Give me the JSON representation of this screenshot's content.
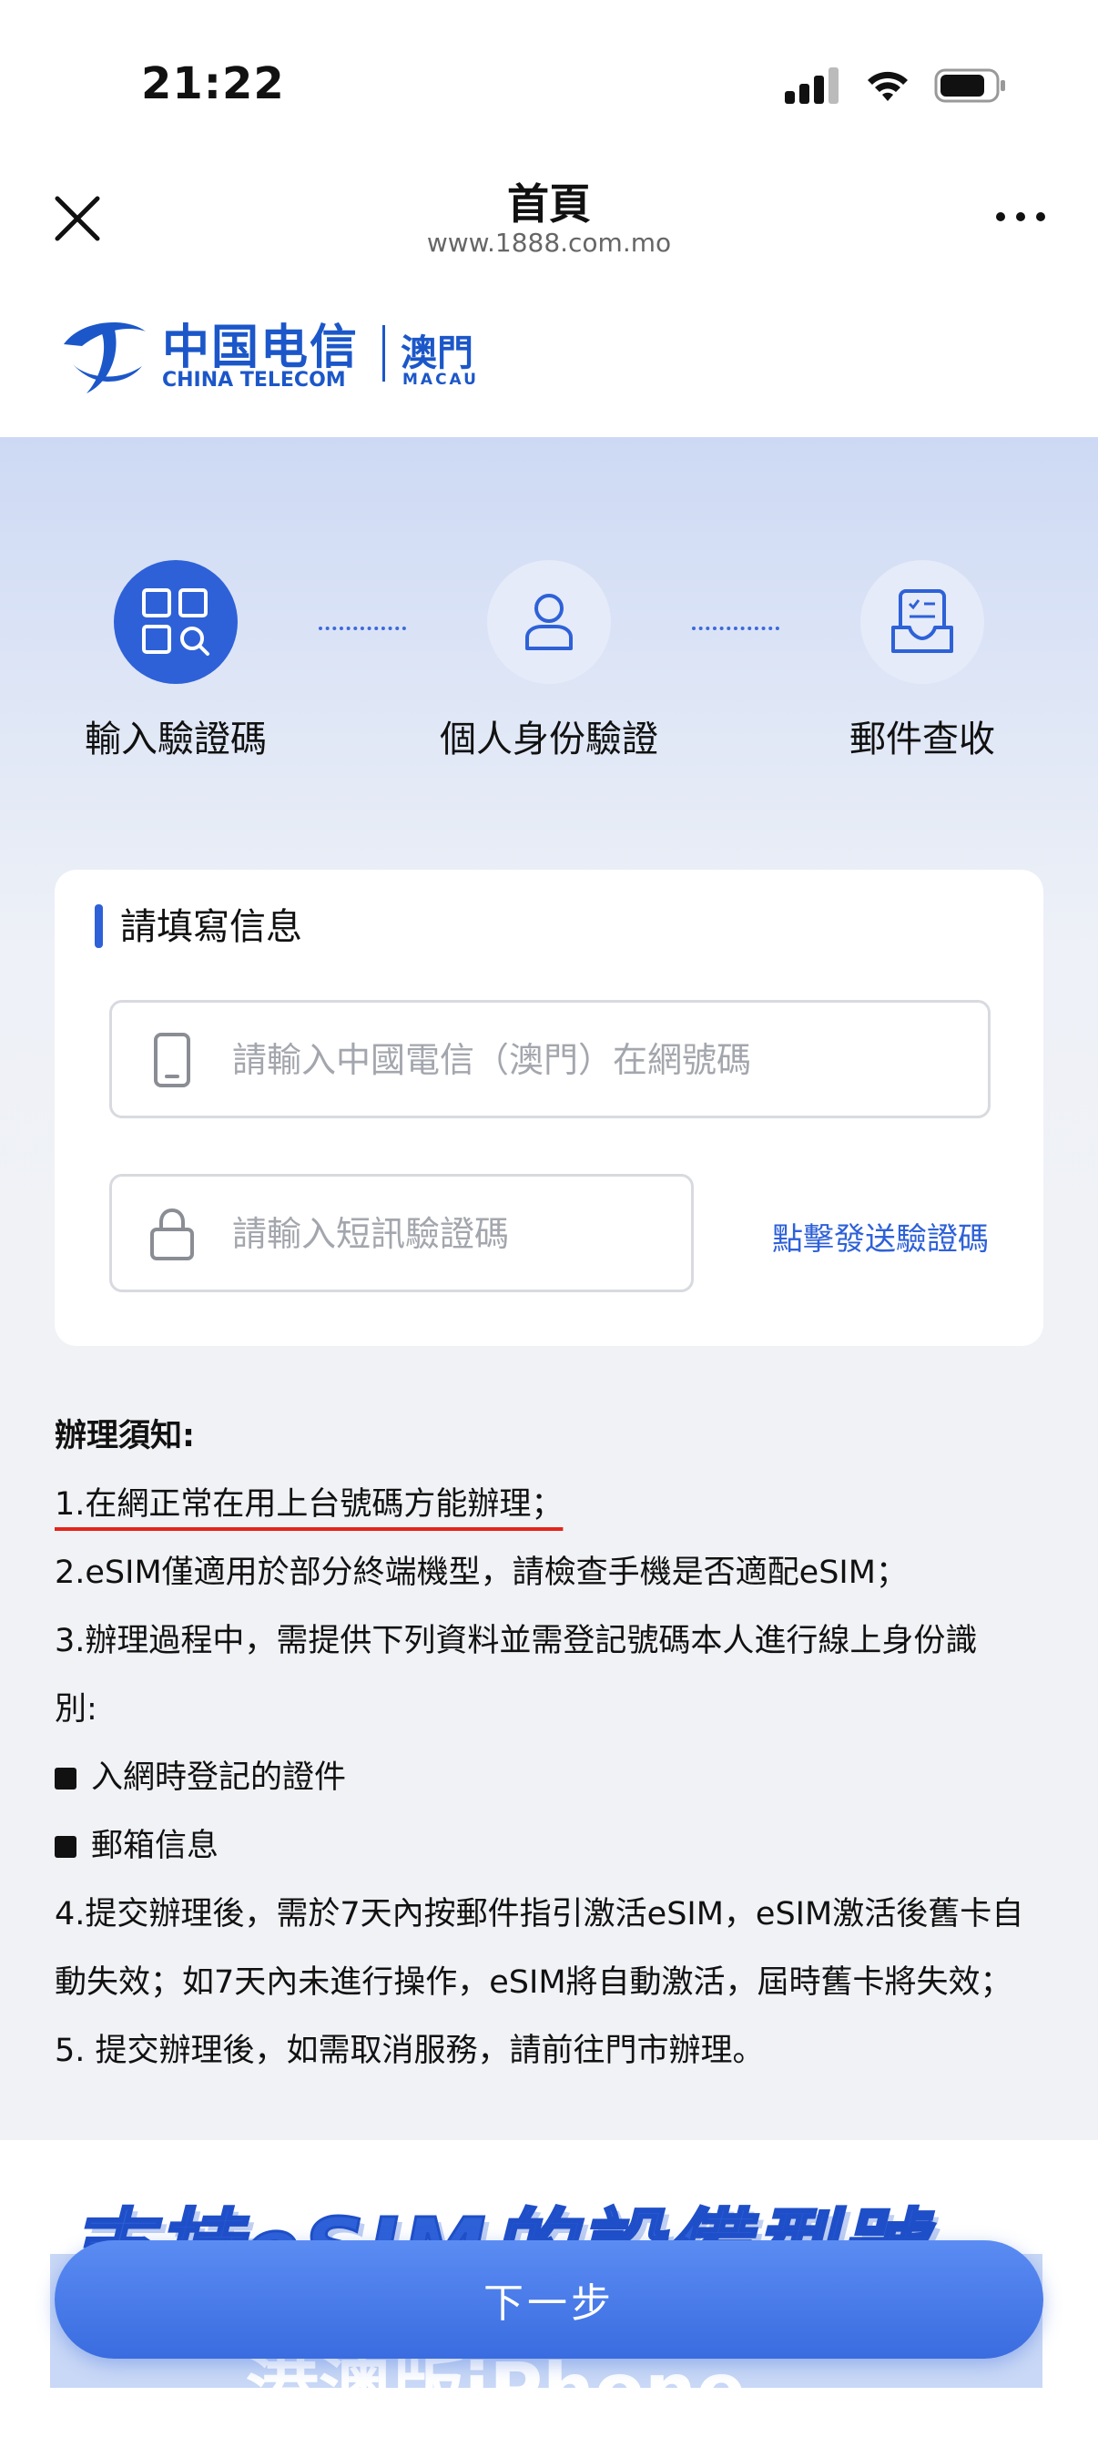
{
  "status_bar": {
    "time": "21:22",
    "signal_icon": "cellular-signal-icon",
    "wifi_icon": "wifi-icon",
    "battery_icon": "battery-icon"
  },
  "navbar": {
    "title": "首頁",
    "url": "www.1888.com.mo"
  },
  "logo": {
    "cn": "中国电信",
    "en": "CHINA TELECOM",
    "region_cn": "澳門",
    "region_en": "MACAU"
  },
  "steps": [
    {
      "label": "輸入驗證碼",
      "icon": "grid-search-icon",
      "active": true
    },
    {
      "label": "個人身份驗證",
      "icon": "person-icon",
      "active": false
    },
    {
      "label": "郵件查收",
      "icon": "mail-list-icon",
      "active": false
    }
  ],
  "form": {
    "title": "請填寫信息",
    "phone_placeholder": "請輸入中國電信（澳門）在網號碼",
    "code_placeholder": "請輸入短訊驗證碼",
    "send_code": "點擊發送驗證碼"
  },
  "notice": {
    "title": "辦理須知:",
    "items": [
      "1.在網正常在用上台號碼方能辦理；",
      "2.eSIM僅適用於部分終端機型，請檢查手機是否適配eSIM；",
      "3.辦理過程中，需提供下列資料並需登記號碼本人進行線上身份識",
      "別:",
      "入網時登記的證件",
      "郵箱信息",
      "4.提交辦理後，需於7天內按郵件指引激活eSIM，eSIM激活後舊卡自",
      "動失效；如7天內未進行操作，eSIM將自動激活，屆時舊卡將失效；",
      "5. 提交辦理後，如需取消服務，請前往門市辦理。"
    ]
  },
  "promo": {
    "heading": "支持eSIM的設備型號",
    "sub": "港澳版iPhone"
  },
  "next_button": "下一步",
  "colors": {
    "accent": "#2e61d8",
    "underline_red": "#e1251b"
  }
}
